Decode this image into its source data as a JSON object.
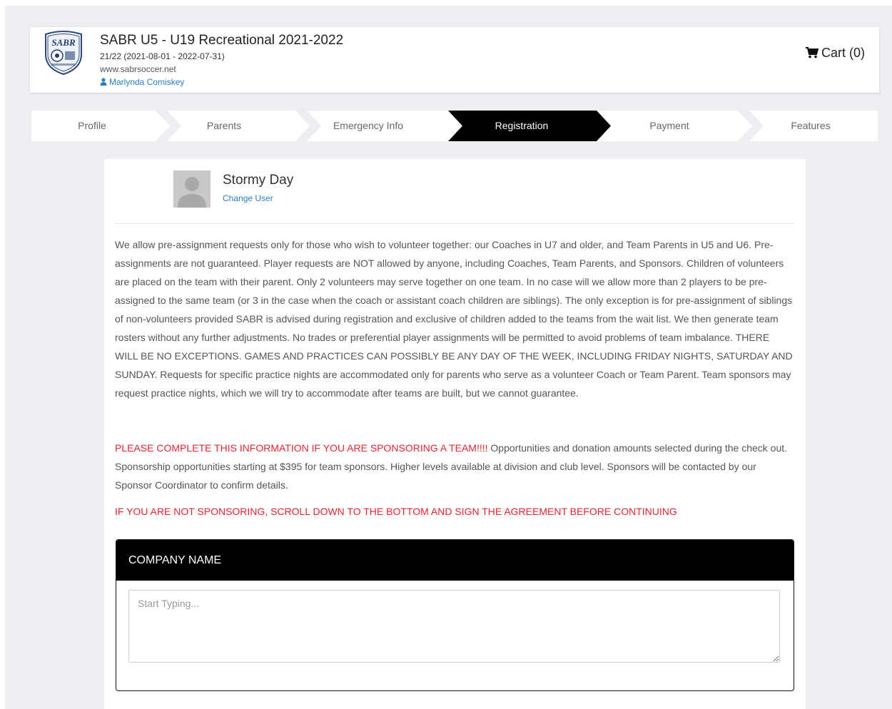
{
  "header": {
    "org_title": "SABR U5 - U19 Recreational 2021-2022",
    "season": "21/22 (2021-08-01 - 2022-07-31)",
    "website": "www.sabrsoccer.net",
    "user_name": "Marlynda Comiskey",
    "cart_label": "Cart (0)",
    "logo_text": "SABR"
  },
  "steps": [
    {
      "label": "Profile",
      "active": false
    },
    {
      "label": "Parents",
      "active": false
    },
    {
      "label": "Emergency Info",
      "active": false
    },
    {
      "label": "Registration",
      "active": true
    },
    {
      "label": "Payment",
      "active": false
    },
    {
      "label": "Features",
      "active": false
    }
  ],
  "player": {
    "name": "Stormy Day",
    "change_user_label": "Change User"
  },
  "content": {
    "policy_text": "We allow pre-assignment requests only for those who wish to volunteer together: our Coaches in U7 and older, and Team Parents in U5 and U6. Pre-assignments are not guaranteed. Player requests are NOT allowed by anyone, including Coaches, Team Parents, and Sponsors. Children of volunteers are placed on the team with their parent. Only 2 volunteers may serve together on one team. In no case will we allow more than 2 players to be pre-assigned to the same team (or 3 in the case when the coach or assistant coach children are siblings). The only exception is for pre-assignment of siblings of non-volunteers provided SABR is advised during registration and exclusive of children added to the teams from the wait list. We then generate team rosters without any further adjustments. No trades or preferential player assignments will be permitted to avoid problems of team imbalance. THERE WILL BE NO EXCEPTIONS. GAMES AND PRACTICES CAN POSSIBLY BE ANY DAY OF THE WEEK, INCLUDING FRIDAY NIGHTS, SATURDAY AND SUNDAY. Requests for specific practice nights are accommodated only for parents who serve as a volunteer Coach or Team Parent. Team sponsors may request practice nights, which we will try to accommodate after teams are built, but we cannot guarantee.",
    "sponsor_alert": "PLEASE COMPLETE THIS INFORMATION IF YOU ARE SPONSORING A TEAM!!!!",
    "sponsor_text": " Opportunities and donation amounts selected during the check out. Sponsorship opportunities starting at $395 for team sponsors. Higher levels available at division and club level. Sponsors will be contacted by our Sponsor Coordinator to confirm details.",
    "not_sponsoring_alert": "IF YOU ARE NOT SPONSORING, SCROLL DOWN TO THE BOTTOM AND SIGN THE AGREEMENT BEFORE CONTINUING"
  },
  "company": {
    "heading": "COMPANY NAME",
    "placeholder": "Start Typing...",
    "value": ""
  },
  "colors": {
    "link": "#2a7fc1",
    "alert_red": "#e8232e",
    "active_step": "#000000",
    "page_bg": "#eceef1"
  },
  "icons": {
    "user": "user-icon",
    "cart": "cart-icon",
    "avatar": "person-silhouette-icon"
  }
}
